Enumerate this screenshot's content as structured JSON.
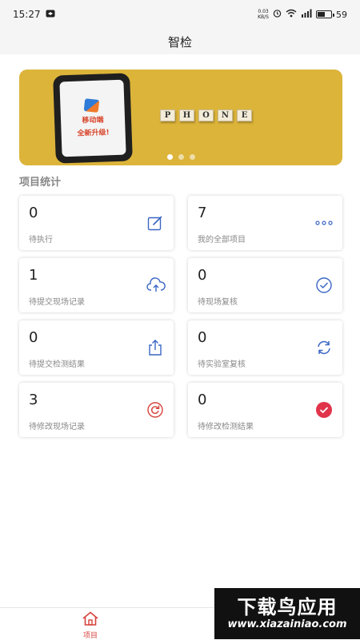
{
  "status_bar": {
    "time": "15:27",
    "net_speed_value": "0.03",
    "net_speed_unit": "KB/S",
    "battery": "59"
  },
  "header": {
    "title": "智检"
  },
  "banner": {
    "phone_text_line1": "移动端",
    "phone_text_line2": "全新升级!",
    "tiles": [
      "P",
      "H",
      "O",
      "N",
      "E"
    ],
    "active_slide": 1,
    "slide_count": 3
  },
  "section": {
    "title": "项目统计"
  },
  "cards": [
    {
      "count": "0",
      "label": "待执行",
      "icon": "edit-icon"
    },
    {
      "count": "7",
      "label": "我的全部项目",
      "icon": "more-dots-icon"
    },
    {
      "count": "1",
      "label": "待提交现场记录",
      "icon": "cloud-upload-icon"
    },
    {
      "count": "0",
      "label": "待现场复核",
      "icon": "check-circle-icon"
    },
    {
      "count": "0",
      "label": "待提交检测结果",
      "icon": "share-upload-icon"
    },
    {
      "count": "0",
      "label": "待实验室复核",
      "icon": "refresh-icon"
    },
    {
      "count": "3",
      "label": "待修改现场记录",
      "icon": "redo-circle-icon"
    },
    {
      "count": "0",
      "label": "待修改检测结果",
      "icon": "check-filled-icon"
    }
  ],
  "bottom_nav": {
    "home_label": "项目"
  },
  "watermark": {
    "line1": "下载鸟应用",
    "line2": "www.xiazainiao.com"
  },
  "colors": {
    "accent_blue": "#3a66c4",
    "accent_red": "#d6423c",
    "banner_yellow": "#dcb43a"
  }
}
